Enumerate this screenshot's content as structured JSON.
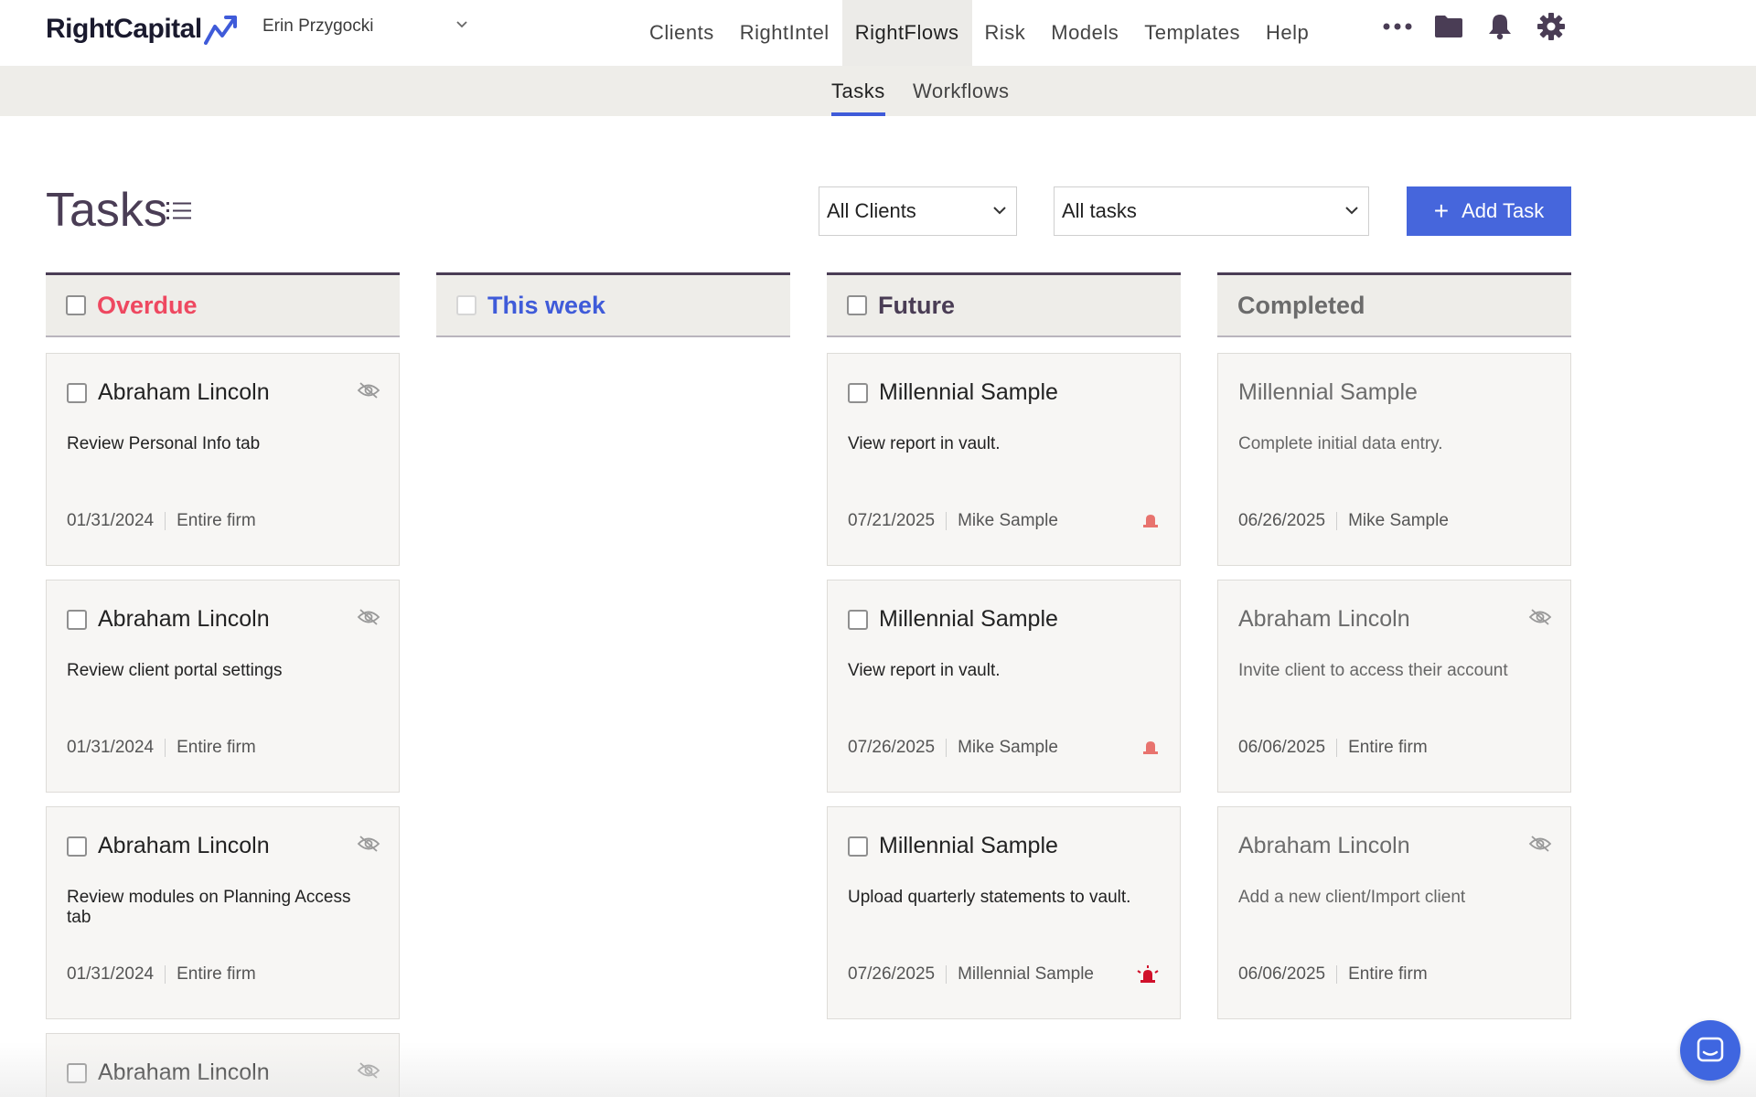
{
  "brand": {
    "name": "RightCapital"
  },
  "user_switcher": {
    "name": "Erin Przygocki"
  },
  "nav": {
    "items": [
      "Clients",
      "RightIntel",
      "RightFlows",
      "Risk",
      "Models",
      "Templates",
      "Help"
    ],
    "active": "RightFlows"
  },
  "subnav": {
    "tasks": "Tasks",
    "workflows": "Workflows"
  },
  "page": {
    "title": "Tasks"
  },
  "filters": {
    "clients": "All Clients",
    "tasks": "All tasks"
  },
  "add_task": {
    "label": "Add Task"
  },
  "columns": {
    "overdue": {
      "title": "Overdue",
      "color": "#ee4860"
    },
    "this_week": {
      "title": "This week",
      "color": "#3f5bd9"
    },
    "future": {
      "title": "Future",
      "color": "#4a3d55"
    },
    "completed": {
      "title": "Completed",
      "color": "#6b6b6b"
    }
  },
  "overdue_cards": [
    {
      "client": "Abraham Lincoln",
      "desc": "Review Personal Info tab",
      "date": "01/31/2024",
      "assignee": "Entire firm"
    },
    {
      "client": "Abraham Lincoln",
      "desc": "Review client portal settings",
      "date": "01/31/2024",
      "assignee": "Entire firm"
    },
    {
      "client": "Abraham Lincoln",
      "desc": "Review modules on Planning Access tab",
      "date": "01/31/2024",
      "assignee": "Entire firm"
    },
    {
      "client": "Abraham Lincoln"
    }
  ],
  "future_cards": [
    {
      "client": "Millennial Sample",
      "desc": "View report in vault.",
      "date": "07/21/2025",
      "assignee": "Mike Sample",
      "alert_color": "#e8736e"
    },
    {
      "client": "Millennial Sample",
      "desc": "View report in vault.",
      "date": "07/26/2025",
      "assignee": "Mike Sample",
      "alert_color": "#e8736e"
    },
    {
      "client": "Millennial Sample",
      "desc": "Upload quarterly statements to vault.",
      "date": "07/26/2025",
      "assignee": "Millennial Sample",
      "alert_color": "#d0102a"
    }
  ],
  "completed_cards": [
    {
      "client": "Millennial Sample",
      "desc": "Complete initial data entry.",
      "date": "06/26/2025",
      "assignee": "Mike Sample"
    },
    {
      "client": "Abraham Lincoln",
      "desc": "Invite client to access their account",
      "date": "06/06/2025",
      "assignee": "Entire firm"
    },
    {
      "client": "Abraham Lincoln",
      "desc": "Add a new client/Import client",
      "date": "06/06/2025",
      "assignee": "Entire firm"
    }
  ]
}
